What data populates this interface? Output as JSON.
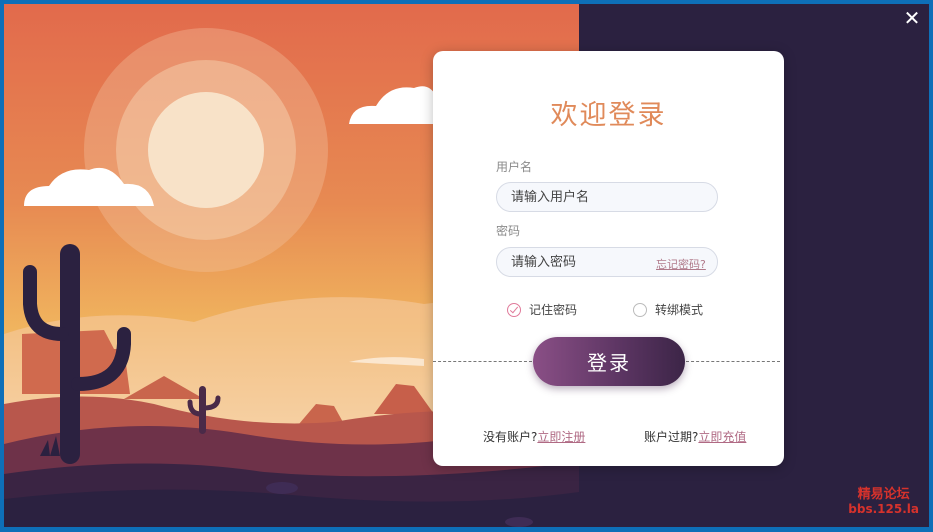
{
  "window": {
    "close_symbol": "✕"
  },
  "login": {
    "title": "欢迎登录",
    "username_label": "用户名",
    "username_placeholder": "请输入用户名",
    "password_label": "密码",
    "password_placeholder": "请输入密码",
    "forgot_link": "忘记密码?",
    "remember_label": "记住密码",
    "remember_checked": true,
    "bind_mode_label": "转绑模式",
    "bind_mode_checked": false,
    "submit_label": "登录",
    "no_account_text": "没有账户?",
    "register_link": "立即注册",
    "expired_text": "账户过期?",
    "recharge_link": "立即充值"
  },
  "watermark": {
    "line1": "精易论坛",
    "line2": "bbs.125.la"
  },
  "colors": {
    "title": "#e08a5a",
    "button_start": "#8a4f86",
    "button_end": "#3c2547",
    "link": "#b06a84",
    "dark_bg": "#2b2140"
  }
}
